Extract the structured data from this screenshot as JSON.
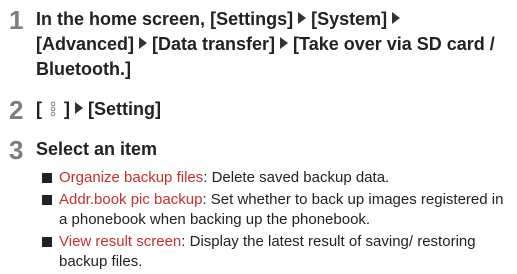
{
  "steps": [
    {
      "number": "1",
      "lead": "In the home screen,",
      "path": [
        "[Settings]",
        "[System]",
        "[Advanced]",
        "[Data transfer]",
        "[Take over via SD card / Bluetooth.]"
      ]
    },
    {
      "number": "2",
      "open_bracket": "[",
      "icon": "menu-dots-icon",
      "close_bracket": "]",
      "target": "[Setting]"
    },
    {
      "number": "3",
      "text": "Select an item"
    }
  ],
  "items": [
    {
      "name": "Organize backup files",
      "desc": ": Delete saved backup data."
    },
    {
      "name": "Addr.book pic backup",
      "desc": ": Set whether to back up images registered in a phonebook when backing up the phonebook."
    },
    {
      "name": "View result screen",
      "desc": ": Display the latest result of saving/ restoring backup files."
    }
  ],
  "colors": {
    "item_name": "#c8302c",
    "step_number": "#7d7d7d",
    "text": "#222222"
  }
}
